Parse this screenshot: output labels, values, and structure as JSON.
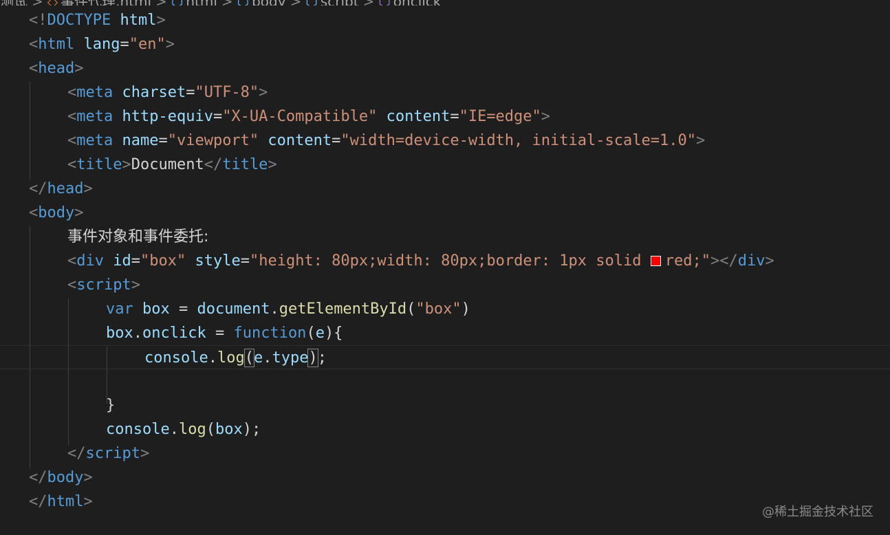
{
  "breadcrumb": {
    "root": "测试",
    "file": "事件代理.html",
    "html": "html",
    "body": "body",
    "script": "script",
    "symbol": "onclick",
    "separator": ">"
  },
  "code": {
    "l1": [
      "<!",
      "DOCTYPE",
      " ",
      "html",
      ">"
    ],
    "l2": [
      "<",
      "html",
      " ",
      "lang",
      "=",
      "\"en\"",
      ">"
    ],
    "l3": [
      "<",
      "head",
      ">"
    ],
    "l4": [
      "<",
      "meta",
      " ",
      "charset",
      "=",
      "\"UTF-8\"",
      ">"
    ],
    "l5": [
      "<",
      "meta",
      " ",
      "http-equiv",
      "=",
      "\"X-UA-Compatible\"",
      " ",
      "content",
      "=",
      "\"IE=edge\"",
      ">"
    ],
    "l6": [
      "<",
      "meta",
      " ",
      "name",
      "=",
      "\"viewport\"",
      " ",
      "content",
      "=",
      "\"width=device-width, initial-scale=1.0\"",
      ">"
    ],
    "l7": [
      "<",
      "title",
      ">",
      "Document",
      "</",
      "title",
      ">"
    ],
    "l8": [
      "</",
      "head",
      ">"
    ],
    "l9": [
      "<",
      "body",
      ">"
    ],
    "l10": "事件对象和事件委托:",
    "l11": [
      "<",
      "div",
      " ",
      "id",
      "=",
      "\"box\"",
      " ",
      "style",
      "=",
      "\"height: 80px;width: 80px;border: 1px solid ",
      "red;\"",
      "></",
      "div",
      ">"
    ],
    "l12": [
      "<",
      "script",
      ">"
    ],
    "l13": [
      "var",
      " ",
      "box",
      " = ",
      "document",
      ".",
      "getElementById",
      "(",
      "\"box\"",
      ")"
    ],
    "l14": [
      "box",
      ".",
      "onclick",
      " = ",
      "function",
      "(",
      "e",
      "){"
    ],
    "l15": [
      "console",
      ".",
      "log",
      "(",
      "e",
      ".",
      "type",
      ")",
      ";"
    ],
    "l17": "}",
    "l18": [
      "console",
      ".",
      "log",
      "(",
      "box",
      ");"
    ],
    "l19": [
      "</",
      "script",
      ">"
    ],
    "l20": [
      "</",
      "body",
      ">"
    ],
    "l21": [
      "</",
      "html",
      ">"
    ]
  },
  "colors": {
    "background": "#1e1e1e",
    "swatch": "#ff0000"
  },
  "watermark": "@稀土掘金技术社区"
}
